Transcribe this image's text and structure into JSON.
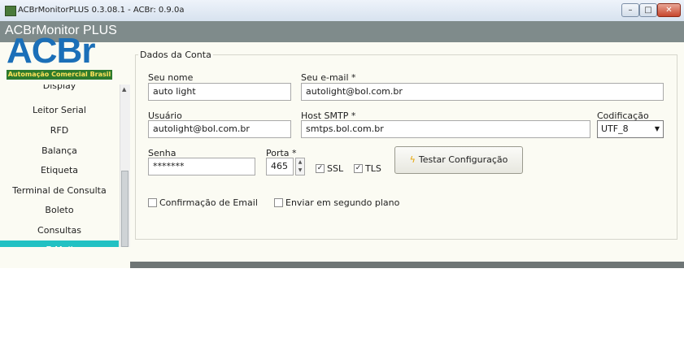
{
  "window": {
    "title": "ACBrMonitorPLUS 0.3.08.1 - ACBr: 0.9.0a",
    "controls": {
      "minimize": "–",
      "maximize": "□",
      "close": "✕"
    }
  },
  "sidebar": {
    "header": "ACBrMonitor PLUS",
    "logo": {
      "text": "ACBr",
      "tagline": "Automação Comercial Brasil"
    },
    "items": [
      {
        "label": "Display"
      },
      {
        "label": "Leitor Serial"
      },
      {
        "label": "RFD"
      },
      {
        "label": "Balança"
      },
      {
        "label": "Etiqueta"
      },
      {
        "label": "Terminal de Consulta"
      },
      {
        "label": "Boleto"
      },
      {
        "label": "Consultas"
      },
      {
        "label": "E-Mail"
      }
    ],
    "active_item": "E-Mail"
  },
  "form": {
    "group_title": "Dados da Conta",
    "nome": {
      "label": "Seu nome",
      "value": "auto light"
    },
    "email": {
      "label": "Seu e-mail *",
      "value": "autolight@bol.com.br"
    },
    "usuario": {
      "label": "Usuário",
      "value": "autolight@bol.com.br"
    },
    "host": {
      "label": "Host SMTP *",
      "value": "smtps.bol.com.br"
    },
    "codificacao": {
      "label": "Codificação",
      "value": "UTF_8"
    },
    "senha": {
      "label": "Senha",
      "value": "*******"
    },
    "porta": {
      "label": "Porta *",
      "value": "465"
    },
    "ssl": {
      "label": "SSL",
      "checked": true
    },
    "tls": {
      "label": "TLS",
      "checked": true
    },
    "testar_button": "Testar Configuração",
    "confirmacao": {
      "label": "Confirmação de Email",
      "checked": false
    },
    "segundo_plano": {
      "label": "Enviar em segundo plano",
      "checked": false
    }
  },
  "colors": {
    "header_bg": "#7f8b8b",
    "active_item_bg": "#22c1c3",
    "panel_bg": "#fbfbf3"
  }
}
